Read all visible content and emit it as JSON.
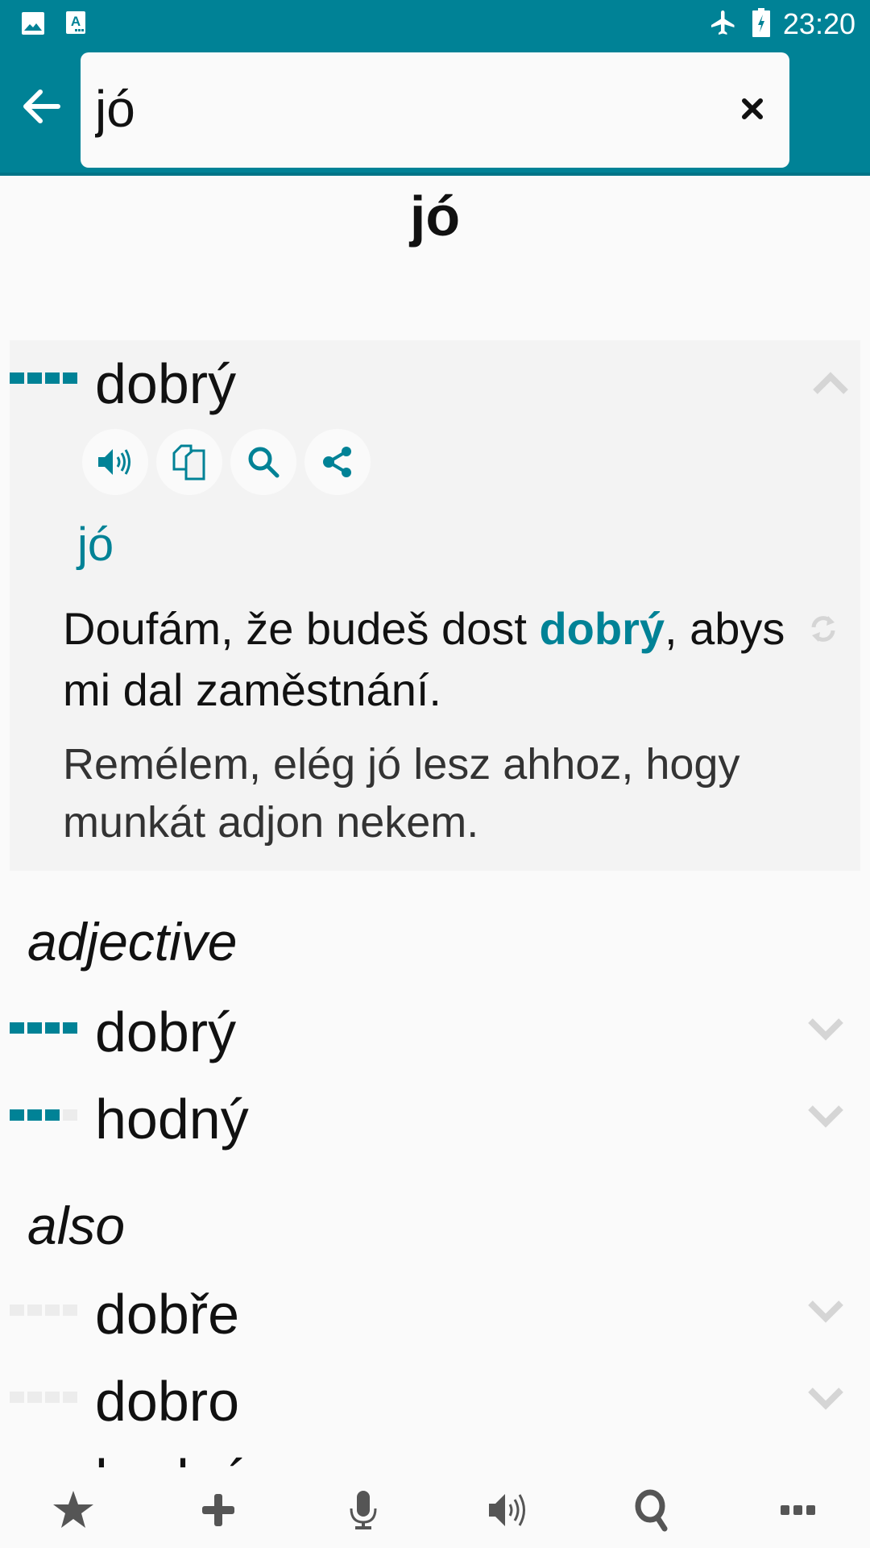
{
  "status_bar": {
    "time": "23:20",
    "left_icons": [
      "gallery-notification-icon",
      "translate-notification-icon"
    ],
    "right_icons": [
      "airplane-mode-icon",
      "battery-charging-icon"
    ]
  },
  "search": {
    "value": "jó",
    "placeholder": "",
    "back_icon": "arrow-left-icon",
    "clear_icon": "close-icon"
  },
  "headword": "jó",
  "expanded_entry": {
    "word": "dobrý",
    "frequency": 4,
    "actions": [
      "speaker-icon",
      "copy-icon",
      "search-icon",
      "share-icon"
    ],
    "source_word": "jó",
    "example_cz_before": "Doufám, že budeš dost ",
    "example_cz_highlight": "dobrý",
    "example_cz_after": ", abys mi dal zaměstnání.",
    "example_hu": "Remélem, elég jó lesz ahhoz, hogy munkát adjon nekem."
  },
  "sections": [
    {
      "title": "adjective",
      "entries": [
        {
          "word": "dobrý",
          "frequency": 4
        },
        {
          "word": "hodný",
          "frequency": 3
        }
      ]
    },
    {
      "title": "also",
      "entries": [
        {
          "word": "dobře",
          "frequency": 0
        },
        {
          "word": "dobro",
          "frequency": 0
        },
        {
          "word": "hodný",
          "frequency": 0
        }
      ]
    }
  ],
  "bottom_nav": [
    "star-icon",
    "plus-icon",
    "microphone-icon",
    "speaker-icon",
    "search-icon",
    "more-icon"
  ],
  "colors": {
    "accent": "#008296",
    "card_bg": "#f3f3f3",
    "page_bg": "#fafafa",
    "icon_gray": "#555555",
    "chevron_gray": "#d5d5d5"
  }
}
